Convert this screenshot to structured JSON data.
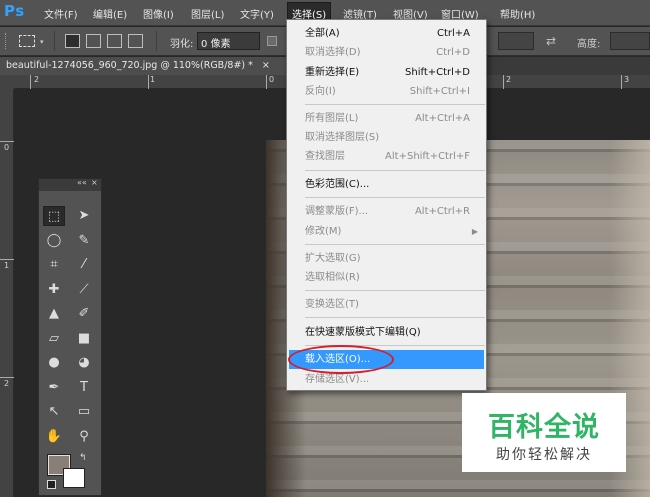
{
  "app": {
    "logo": "Ps"
  },
  "menubar": {
    "items": [
      "文件(F)",
      "编辑(E)",
      "图像(I)",
      "图层(L)",
      "文字(Y)",
      "选择(S)",
      "滤镜(T)",
      "视图(V)",
      "窗口(W)",
      "帮助(H)"
    ],
    "active": "选择(S)"
  },
  "options": {
    "feather_label": "羽化:",
    "feather_value": "0 像素",
    "height_label": "高度:"
  },
  "document": {
    "tab_title": "beautiful-1274056_960_720.jpg @ 110%(RGB/8#) *",
    "tab_close": "×"
  },
  "rulers": {
    "top": [
      "2",
      "1",
      "0",
      "1",
      "2",
      "3"
    ],
    "left": [
      "0",
      "1",
      "2"
    ]
  },
  "select_menu": {
    "items": [
      {
        "label": "全部(A)",
        "shortcut": "Ctrl+A",
        "enabled": true
      },
      {
        "label": "取消选择(D)",
        "shortcut": "Ctrl+D",
        "enabled": false
      },
      {
        "label": "重新选择(E)",
        "shortcut": "Shift+Ctrl+D",
        "enabled": true
      },
      {
        "label": "反向(I)",
        "shortcut": "Shift+Ctrl+I",
        "enabled": false
      },
      {
        "label": "所有图层(L)",
        "shortcut": "Alt+Ctrl+A",
        "enabled": false
      },
      {
        "label": "取消选择图层(S)",
        "shortcut": "",
        "enabled": false
      },
      {
        "label": "查找图层",
        "shortcut": "Alt+Shift+Ctrl+F",
        "enabled": false
      },
      {
        "label": "色彩范围(C)...",
        "shortcut": "",
        "enabled": true
      },
      {
        "label": "调整蒙版(F)...",
        "shortcut": "Alt+Ctrl+R",
        "enabled": false
      },
      {
        "label": "修改(M)",
        "shortcut": "",
        "enabled": false,
        "submenu": true
      },
      {
        "label": "扩大选取(G)",
        "shortcut": "",
        "enabled": false
      },
      {
        "label": "选取相似(R)",
        "shortcut": "",
        "enabled": false
      },
      {
        "label": "变换选区(T)",
        "shortcut": "",
        "enabled": false
      },
      {
        "label": "在快速蒙版模式下编辑(Q)",
        "shortcut": "",
        "enabled": true
      },
      {
        "label": "载入选区(O)...",
        "shortcut": "",
        "enabled": true,
        "highlighted": true
      },
      {
        "label": "存储选区(V)...",
        "shortcut": "",
        "enabled": false
      }
    ]
  },
  "watermark": {
    "title": "百科全说",
    "subtitle": "助你轻松解决"
  },
  "colors": {
    "highlight": "#3399ff",
    "annotation_circle": "#d81e2a",
    "watermark_green": "#2fb565",
    "foreground": "#8a7f78",
    "background": "#ffffff"
  }
}
